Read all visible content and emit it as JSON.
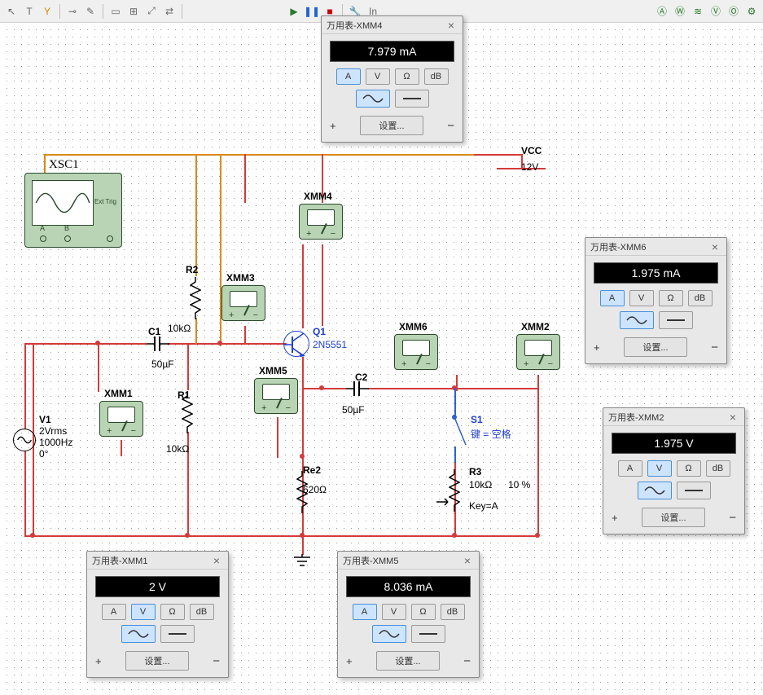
{
  "toolbar": {
    "play": "▶",
    "pause": "❚❚",
    "stop": "■",
    "interactive": "In"
  },
  "scope": {
    "name": "XSC1",
    "ext": "Ext Trig",
    "chA": "A",
    "chB": "B"
  },
  "source": {
    "name": "V1",
    "amp": "2Vrms",
    "freq": "1000Hz",
    "phase": "0°"
  },
  "vcc": {
    "name": "VCC",
    "val": "12V"
  },
  "c1": {
    "name": "C1",
    "val": "50µF"
  },
  "c2": {
    "name": "C2",
    "val": "50µF"
  },
  "r1": {
    "name": "R1",
    "val": "10kΩ"
  },
  "r2": {
    "name": "R2",
    "val": "10kΩ"
  },
  "re2": {
    "name": "Re2",
    "val": "620Ω"
  },
  "r3": {
    "name": "R3",
    "val": "10kΩ",
    "pct": "10 %",
    "key": "Key=A"
  },
  "q1": {
    "name": "Q1",
    "model": "2N5551"
  },
  "s1": {
    "name": "S1",
    "key": "键 = 空格"
  },
  "meters": {
    "xmm1": "XMM1",
    "xmm2": "XMM2",
    "xmm3": "XMM3",
    "xmm4": "XMM4",
    "xmm5": "XMM5",
    "xmm6": "XMM6"
  },
  "panels": {
    "xmm4": {
      "title": "万用表-XMM4",
      "reading": "7.979 mA",
      "mode": "A",
      "wave": "ac",
      "settings": "设置..."
    },
    "xmm6": {
      "title": "万用表-XMM6",
      "reading": "1.975 mA",
      "mode": "A",
      "wave": "ac",
      "settings": "设置..."
    },
    "xmm2": {
      "title": "万用表-XMM2",
      "reading": "1.975 V",
      "mode": "V",
      "wave": "ac",
      "settings": "设置..."
    },
    "xmm1": {
      "title": "万用表-XMM1",
      "reading": "2 V",
      "mode": "V",
      "wave": "ac",
      "settings": "设置..."
    },
    "xmm5": {
      "title": "万用表-XMM5",
      "reading": "8.036 mA",
      "mode": "A",
      "wave": "ac",
      "settings": "设置..."
    }
  },
  "btn_labels": {
    "A": "A",
    "V": "V",
    "Ohm": "Ω",
    "dB": "dB"
  }
}
